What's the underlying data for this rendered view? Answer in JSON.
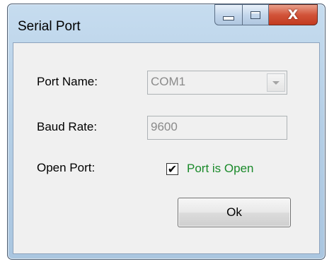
{
  "window": {
    "title": "Serial Port",
    "controls": {
      "minimize": "minimize",
      "maximize": "maximize",
      "close_glyph": "X"
    }
  },
  "form": {
    "port_name_label": "Port Name:",
    "port_name_value": "COM1",
    "baud_rate_label": "Baud Rate:",
    "baud_rate_value": "9600",
    "open_port_label": "Open Port:",
    "port_open_checked": true,
    "port_open_text": "Port is Open",
    "ok_label": "Ok"
  },
  "colors": {
    "status_text": "#1a8a2a",
    "close_button": "#c23a1f",
    "disabled_text": "#8a8a8a"
  },
  "icons": {
    "minimize": "minimize-icon",
    "maximize": "maximize-icon",
    "close": "close-icon",
    "dropdown": "chevron-down-icon",
    "check": "checkmark-icon"
  }
}
